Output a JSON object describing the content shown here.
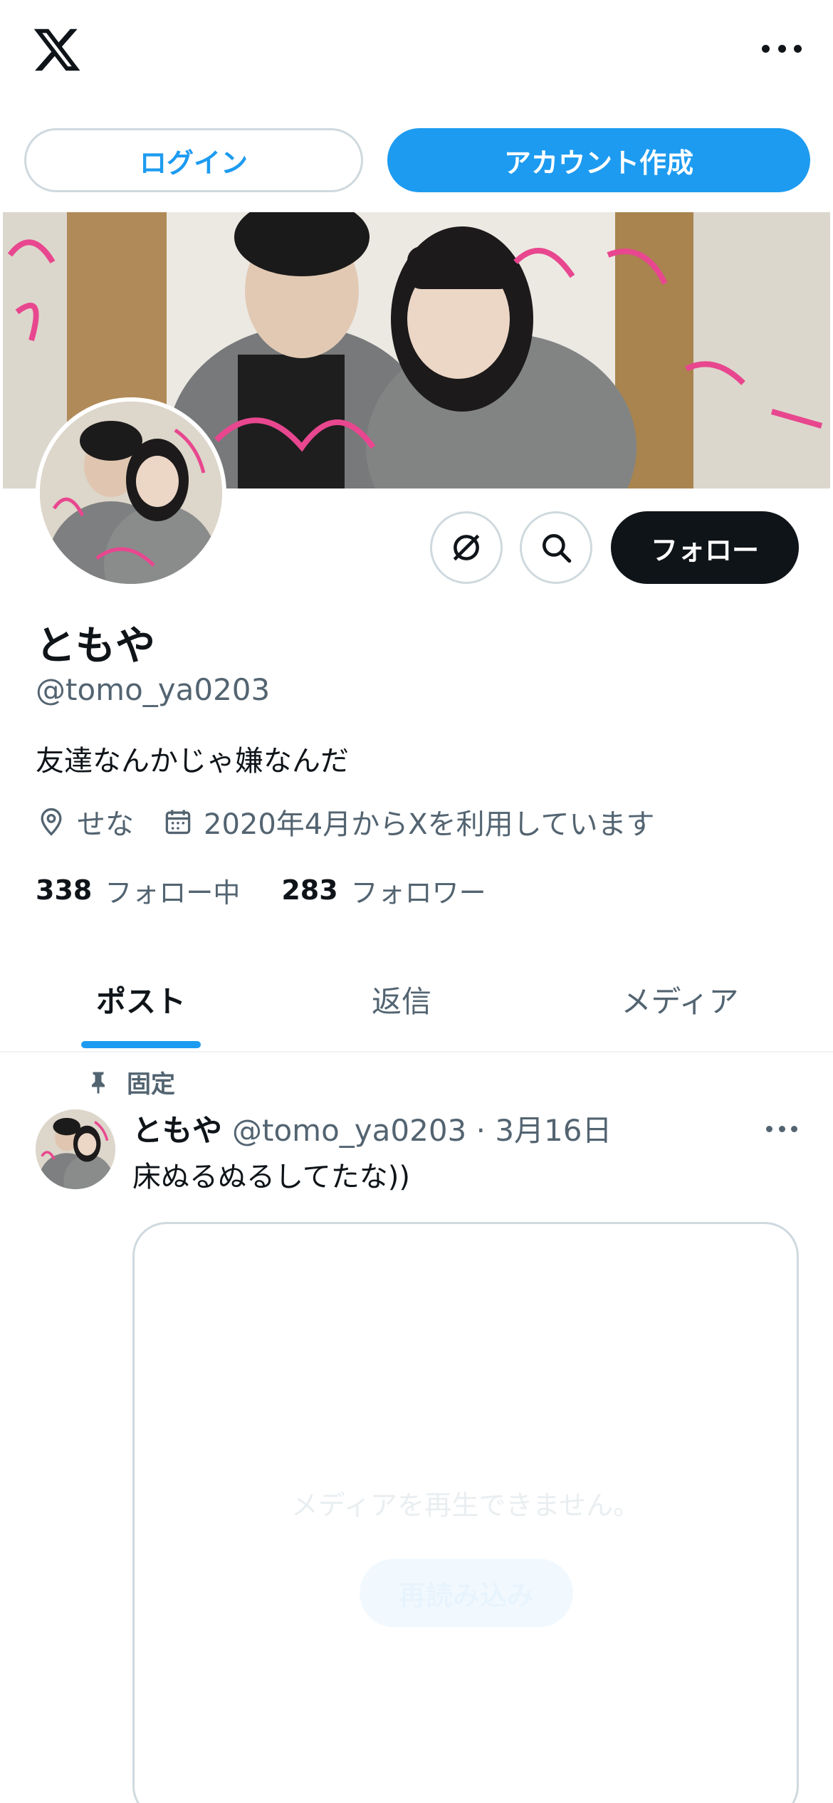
{
  "topbar": {
    "logo_icon": "x-logo-icon",
    "more_icon": "more-horizontal-icon"
  },
  "auth": {
    "login_label": "ログイン",
    "signup_label": "アカウント作成"
  },
  "profile": {
    "name": "ともや",
    "handle": "@tomo_ya0203",
    "bio": "友達なんかじゃ嫌なんだ",
    "location": "せな",
    "joined": "2020年4月からXを利用しています",
    "following_count": "338",
    "following_label": "フォロー中",
    "followers_count": "283",
    "followers_label": "フォロワー",
    "follow_label": "フォロー"
  },
  "tabs": [
    {
      "label": "ポスト",
      "active": true
    },
    {
      "label": "返信",
      "active": false
    },
    {
      "label": "メディア",
      "active": false
    }
  ],
  "post": {
    "pinned_label": "固定",
    "name": "ともや",
    "handle_date": "@tomo_ya0203 · 3月16日",
    "text": "床ぬるぬるしてたな))",
    "media_error": "メディアを再生できません。",
    "retry_label": "再読み込み"
  },
  "colors": {
    "accent": "#1d9bf0",
    "text": "#0f1419",
    "secondary": "#536471",
    "border": "#cfd9de"
  }
}
